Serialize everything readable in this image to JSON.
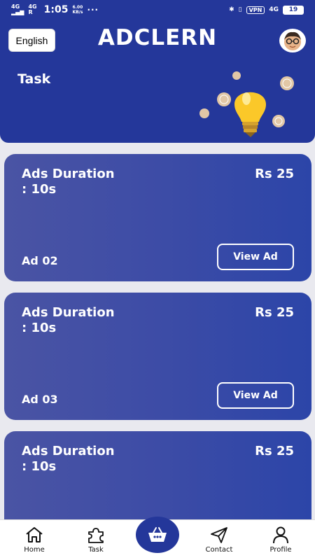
{
  "status_bar": {
    "sig1_top": "4G",
    "sig2_top": "4G",
    "sig2_bottom": "R",
    "time": "1:05",
    "speed_top": "6.00",
    "speed_bottom": "KB/s",
    "dots": "···",
    "vpn": "VPN",
    "net": "4G",
    "battery": "19"
  },
  "header": {
    "language_button": "English",
    "brand": "ADCLERN"
  },
  "banner": {
    "title": "Task"
  },
  "cards": [
    {
      "title": "Ads Duration : 10s",
      "price": "Rs 25",
      "ad_id": "Ad 02",
      "button": "View Ad"
    },
    {
      "title": "Ads Duration : 10s",
      "price": "Rs 25",
      "ad_id": "Ad 03",
      "button": "View Ad"
    },
    {
      "title": "Ads Duration : 10s",
      "price": "Rs 25"
    }
  ],
  "nav": {
    "home": "Home",
    "task": "Task",
    "contact": "Contact",
    "profile": "Profile"
  },
  "colors": {
    "primary": "#24379a",
    "card_gradient_start": "#4a54a4",
    "card_gradient_end": "#2c45a8",
    "background": "#e9e9ef"
  },
  "icons": {
    "home": "home-icon",
    "task": "puzzle-icon",
    "center": "basket-icon",
    "contact": "send-icon",
    "profile": "user-icon"
  }
}
